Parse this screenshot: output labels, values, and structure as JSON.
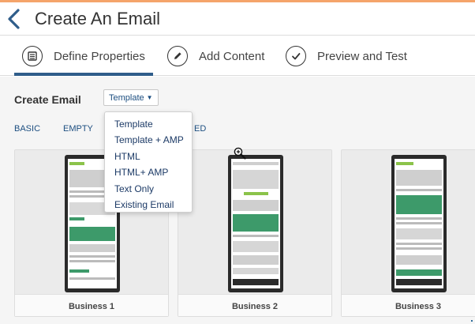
{
  "header": {
    "title": "Create An Email",
    "back_icon": "chevron-left-icon"
  },
  "steps": [
    {
      "label": "Define Properties",
      "icon": "form-icon",
      "active": true
    },
    {
      "label": "Add Content",
      "icon": "pencil-icon",
      "active": false
    },
    {
      "label": "Preview and Test",
      "icon": "check-icon",
      "active": false
    }
  ],
  "create": {
    "label": "Create Email",
    "selected_type": "Template"
  },
  "tabs": {
    "basic": "BASIC",
    "empty": "EMPTY",
    "partial": "ED"
  },
  "dropdown": {
    "options": [
      "Template",
      "Template + AMP",
      "HTML",
      "HTML+ AMP",
      "Text Only",
      "Existing Email"
    ]
  },
  "cards": [
    {
      "name": "Business 1"
    },
    {
      "name": "Business 2"
    },
    {
      "name": "Business 3"
    }
  ],
  "colors": {
    "accent": "#f5a46a",
    "active_underline": "#2f5d8a",
    "link": "#1c4e80",
    "template_green": "#3d9a6a"
  }
}
